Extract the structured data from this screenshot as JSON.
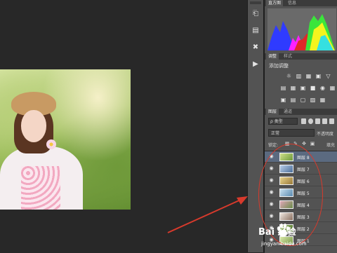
{
  "panels": {
    "histogram_tabs": [
      "直方图",
      "信息"
    ],
    "adjust_tabs": [
      "调整",
      "样式"
    ],
    "adjust_title": "添加调整",
    "layers_tabs": [
      "图层",
      "通道"
    ]
  },
  "layers": {
    "kind_filter": "ρ 类型",
    "blend_mode": "正常",
    "opacity_label": "不透明度",
    "lock_label": "锁定:",
    "fill_label": "填充",
    "items": [
      {
        "name": "图层 8",
        "selected": true
      },
      {
        "name": "图层 7",
        "selected": false
      },
      {
        "name": "图层 6",
        "selected": false
      },
      {
        "name": "图层 5",
        "selected": false
      },
      {
        "name": "图层 4",
        "selected": false
      },
      {
        "name": "图层 3",
        "selected": false
      },
      {
        "name": "图层 2",
        "selected": false
      },
      {
        "name": "图层 1",
        "selected": false
      }
    ]
  },
  "watermark": {
    "logo": "Bai 经验",
    "url": "jingyan.baidu.com"
  },
  "icons": {
    "tools": [
      "history-icon",
      "properties-icon",
      "brush-settings-icon",
      "play-icon"
    ],
    "visibility": "eye-icon"
  },
  "colors": {
    "annotation_red": "#d83a2c",
    "selection_blue": "#5b6a80"
  }
}
